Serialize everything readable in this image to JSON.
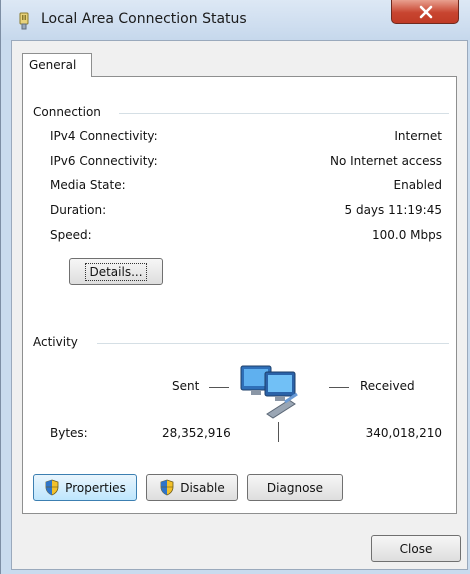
{
  "window": {
    "title": "Local Area Connection Status",
    "close_label": "X"
  },
  "tabs": [
    {
      "label": "General",
      "selected": true
    }
  ],
  "connection": {
    "group_label": "Connection",
    "rows": [
      {
        "label": "IPv4 Connectivity:",
        "value": "Internet"
      },
      {
        "label": "IPv6 Connectivity:",
        "value": "No Internet access"
      },
      {
        "label": "Media State:",
        "value": "Enabled"
      },
      {
        "label": "Duration:",
        "value": "5 days 11:19:45"
      },
      {
        "label": "Speed:",
        "value": "100.0 Mbps"
      }
    ],
    "details_button": "Details..."
  },
  "activity": {
    "group_label": "Activity",
    "sent_label": "Sent",
    "received_label": "Received",
    "bytes_label": "Bytes:",
    "bytes_sent": "28,352,916",
    "bytes_received": "340,018,210"
  },
  "buttons": {
    "properties": "Properties",
    "disable": "Disable",
    "diagnose": "Diagnose",
    "close": "Close"
  },
  "icons": {
    "title": "network-adapter-icon",
    "activity": "network-computers-icon",
    "shield": "uac-shield-icon"
  }
}
